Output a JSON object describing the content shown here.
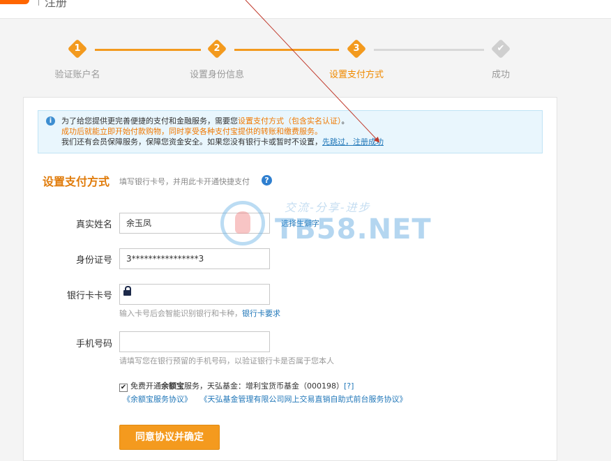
{
  "header": {
    "title": "注册"
  },
  "steps": [
    {
      "num": "1",
      "label": "验证账户名",
      "state": "complete"
    },
    {
      "num": "2",
      "label": "设置身份信息",
      "state": "complete"
    },
    {
      "num": "3",
      "label": "设置支付方式",
      "state": "active"
    },
    {
      "num": "✔",
      "label": "成功",
      "state": "pending"
    }
  ],
  "notice": {
    "line1_pre": "为了给您提供更完善便捷的支付和金融服务，需要您",
    "line1_orange": "设置支付方式（包含实名认证）",
    "line1_post": "。",
    "line2": "成功后就能立即开始付款购物，同时享受各种支付宝提供的转账和缴费服务。",
    "line3_pre": "我们还有会员保障服务，保障您资金安全。如果您没有银行卡或暂时不设置，",
    "line3_link": "先跳过，注册成功"
  },
  "section": {
    "title": "设置支付方式",
    "subtitle": "填写银行卡号，并用此卡开通快捷支付",
    "help": "?"
  },
  "form": {
    "name_label": "真实姓名",
    "name_value": "余玉凤",
    "rare_char_link": "选择生僻字",
    "id_label": "身份证号",
    "id_value": "3****************3",
    "card_label": "银行卡卡号",
    "card_value": "",
    "card_hint": "输入卡号后会智能识别银行和卡种，",
    "card_hint_link": "银行卡要求",
    "phone_label": "手机号码",
    "phone_value": "",
    "phone_hint": "请填写您在银行预留的手机号码，以验证银行卡是否属于您本人"
  },
  "agreement": {
    "check": "✔",
    "text_pre": "免费开通",
    "text_bold": "余额宝",
    "text_post": "服务，天弘基金：增利宝货币基金（000198）",
    "help": "[?]",
    "link1": "《余额宝服务协议》",
    "link2": "《天弘基金管理有限公司网上交易直销自助式前台服务协议》"
  },
  "button": {
    "label": "同意协议并确定"
  },
  "watermark": {
    "slogan": "交流-分享-进步",
    "brand": "TB58.NET"
  },
  "colors": {
    "accent": "#f39a1e",
    "link": "#1f76b8",
    "notice_bg": "#e9f6fd",
    "annotation": "#c0392b"
  }
}
